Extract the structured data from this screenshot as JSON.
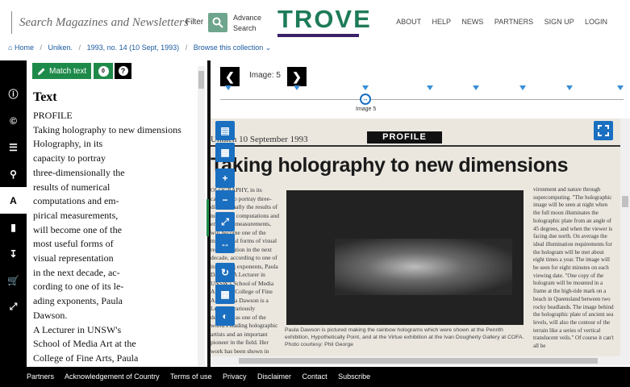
{
  "header": {
    "search_placeholder": "Search Magazines and Newsletters",
    "filter_label": "Filter",
    "advance_line1": "Advance",
    "advance_line2": "Search",
    "logo_text": "TROVE",
    "nav": [
      "ABOUT",
      "HELP",
      "NEWS",
      "PARTNERS",
      "SIGN UP",
      "LOGIN"
    ]
  },
  "breadcrumb": {
    "home": "Home",
    "items": [
      "Uniken.",
      "1993, no. 14 (10 Sept, 1993)",
      "Browse this collection"
    ]
  },
  "sidebar_icons": [
    "info-icon",
    "copyright-icon",
    "list-icon",
    "search-icon",
    "text-icon",
    "bookmark-icon",
    "download-icon",
    "cart-icon",
    "expand-icon"
  ],
  "text_panel": {
    "match_label": "Match text",
    "match_count": "0",
    "help": "?",
    "heading": "Text",
    "lines": [
      "PROFILE",
      "Taking holography to new dimensions",
      "Holography, in its",
      "capacity to portray",
      "three-dimensionally the",
      "results of numerical",
      "computations and em-",
      "pirical measurements,",
      "will become one of the",
      "most useful forms of",
      "visual representation",
      "in the next decade, ac-",
      "cording to one of its le-",
      "ading exponents, Paula",
      "Dawson.",
      "A Lecturer in UNSW's",
      "School of Media Art at the",
      "College of Fine Arts, Paula"
    ]
  },
  "viewer": {
    "image_label": "Image: 5",
    "knob_label": "Image 5",
    "newspaper": {
      "date": "Uniken 10 September 1993",
      "section": "PROFILE",
      "headline": "Taking holography to new dimensions",
      "col1": "OLOGRAPHY, in its capacity to portray three-dimensionally the results of numerical computations and empirical measurements, will become one of the most useful forms of visual representation in the next decade, according to one of its leading exponents, Paula Dawson. A Lecturer in UNSW's School of Media Art at the College of Fine Arts, Paula Dawson is a Lecturer variously described as one of the world's leading holographic artists and an important pioneer in the field. Her work has been shown in Japan, the United States, France, UK, Germany and",
      "caption": "Paula Dawson is pictured making the rainbow holograms which were shown at the Penrith exhibition, Hypothetically Point, and at the Virtue exhibition at the Ivan Dougherty Gallery at COFA. Photo courtesy: Phil George",
      "col3": "vironment and nature through supercomputing. \"The holographic image will be seen at night when the full moon illuminates the holographic plate from an angle of 45 degrees, and when the viewer is facing due north. On average the ideal illumination requirements for the hologram will be met about eight times a year. The image will be seen for eight minutes on each viewing date. \"One copy of the hologram will be mounted in a frame at the high-tide mark on a beach in Queensland between two rocky headlands. The image behind the holographic plate of ancient sea levels, will also the contour of the terrain like a series of vertical translucent veils.\" Of course it can't all be"
    }
  },
  "footer": [
    "Partners",
    "Acknowledgement of Country",
    "Terms of use",
    "Privacy",
    "Disclaimer",
    "Contact",
    "Subscribe"
  ]
}
